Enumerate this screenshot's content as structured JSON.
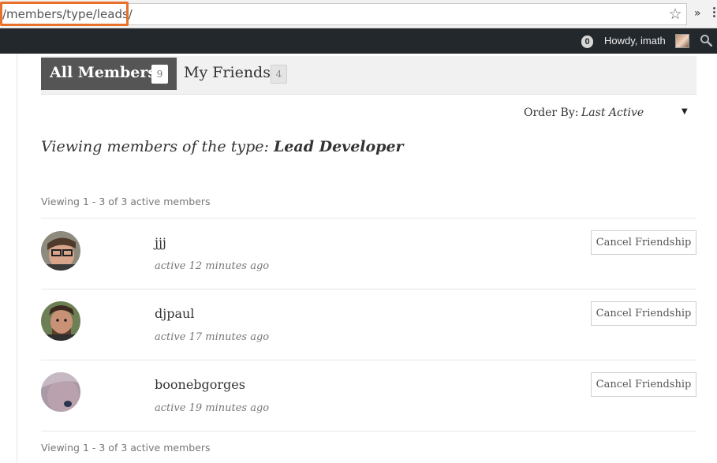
{
  "browser": {
    "url": "/members/type/leads/"
  },
  "admin_bar": {
    "notification_count": "0",
    "howdy": "Howdy, imath"
  },
  "tabs": [
    {
      "label": "All Members",
      "count": "9"
    },
    {
      "label": "My Friends",
      "count": "4"
    }
  ],
  "order_by": {
    "label": "Order By:",
    "value": "Last Active"
  },
  "viewing": {
    "prefix": "Viewing members of the type: ",
    "type": "Lead Developer"
  },
  "pagination": {
    "top": "Viewing 1 - 3 of 3 active members",
    "bottom": "Viewing 1 - 3 of 3 active members"
  },
  "members": [
    {
      "name": "jjj",
      "active": "active 12 minutes ago",
      "button": "Cancel Friendship"
    },
    {
      "name": "djpaul",
      "active": "active 17 minutes ago",
      "button": "Cancel Friendship"
    },
    {
      "name": "boonebgorges",
      "active": "active 19 minutes ago",
      "button": "Cancel Friendship"
    }
  ],
  "colors": {
    "url_highlight": "#e8702a",
    "admin_bar": "#23282d",
    "active_tab": "#555555"
  }
}
